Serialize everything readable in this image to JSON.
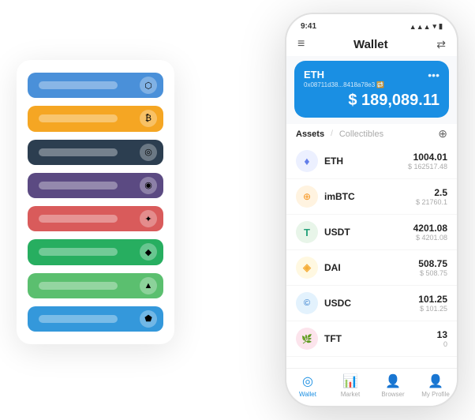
{
  "statusBar": {
    "time": "9:41",
    "signal": "●●●",
    "wifi": "wifi",
    "battery": "battery"
  },
  "nav": {
    "title": "Wallet"
  },
  "walletCard": {
    "coin": "ETH",
    "address": "0x08711d38...8418a78e3 🔁",
    "balance": "$ 189,089.11"
  },
  "assetsTabs": {
    "active": "Assets",
    "slash": "/",
    "inactive": "Collectibles"
  },
  "assets": [
    {
      "name": "ETH",
      "amount": "1004.01",
      "value": "$ 162517.48",
      "icon": "eth",
      "emoji": "♦"
    },
    {
      "name": "imBTC",
      "amount": "2.5",
      "value": "$ 21760.1",
      "icon": "imbtc",
      "emoji": "₿"
    },
    {
      "name": "USDT",
      "amount": "4201.08",
      "value": "$ 4201.08",
      "icon": "usdt",
      "emoji": "₮"
    },
    {
      "name": "DAI",
      "amount": "508.75",
      "value": "$ 508.75",
      "icon": "dai",
      "emoji": "◈"
    },
    {
      "name": "USDC",
      "amount": "101.25",
      "value": "$ 101.25",
      "icon": "usdc",
      "emoji": "©"
    },
    {
      "name": "TFT",
      "amount": "13",
      "value": "0",
      "icon": "tft",
      "emoji": "🌿"
    }
  ],
  "bottomNav": [
    {
      "label": "Wallet",
      "active": true,
      "emoji": "◎"
    },
    {
      "label": "Market",
      "active": false,
      "emoji": "📈"
    },
    {
      "label": "Browser",
      "active": false,
      "emoji": "👤"
    },
    {
      "label": "My Profile",
      "active": false,
      "emoji": "👤"
    }
  ],
  "leftPanel": {
    "cards": [
      {
        "color": "card-blue",
        "label": ""
      },
      {
        "color": "card-yellow",
        "label": ""
      },
      {
        "color": "card-dark",
        "label": ""
      },
      {
        "color": "card-purple",
        "label": ""
      },
      {
        "color": "card-red",
        "label": ""
      },
      {
        "color": "card-green",
        "label": ""
      },
      {
        "color": "card-lightgreen",
        "label": ""
      },
      {
        "color": "card-skyblue",
        "label": ""
      }
    ]
  }
}
